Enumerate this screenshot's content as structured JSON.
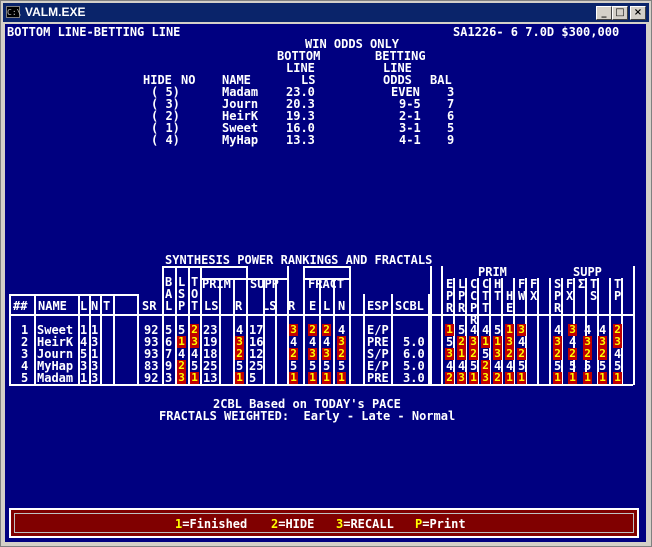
{
  "window": {
    "title": "VALM.EXE",
    "icon_text": "C:\\",
    "buttons": [
      "minimize-icon",
      "maximize-icon",
      "close-icon"
    ]
  },
  "header": {
    "left": "BOTTOM LINE-BETTING LINE",
    "right": "SA1226- 6 7.0D $300,000"
  },
  "odds": {
    "title": "WIN ODDS ONLY",
    "h_bottom": "BOTTOM",
    "h_line": "LINE",
    "h_ls": "LS",
    "h_betting": "BETTING",
    "h_line2": "LINE",
    "h_odds": "ODDS",
    "h_bal": "BAL",
    "h_hide": "HIDE",
    "h_no": "NO",
    "h_name": "NAME",
    "rows": [
      {
        "no": "( 5)",
        "name": "Madam",
        "ls": "23.0",
        "odds": "EVEN",
        "bal": "3"
      },
      {
        "no": "( 3)",
        "name": "Journ",
        "ls": "20.3",
        "odds": "9-5",
        "bal": "7"
      },
      {
        "no": "( 2)",
        "name": "HeirK",
        "ls": "19.3",
        "odds": "2-1",
        "bal": "6"
      },
      {
        "no": "( 1)",
        "name": "Sweet",
        "ls": "16.0",
        "odds": "3-1",
        "bal": "5"
      },
      {
        "no": "( 4)",
        "name": "MyHap",
        "ls": "13.3",
        "odds": "4-1",
        "bal": "9"
      }
    ]
  },
  "synth": {
    "title": "SYNTHESIS POWER RANKINGS AND FRACTALS",
    "headers": {
      "num": "##",
      "name": "NAME",
      "l": "L",
      "n": "N",
      "t": "T",
      "sr": "SR",
      "bal": [
        "B",
        "A",
        "L"
      ],
      "lsp": [
        "L",
        "S",
        "P"
      ],
      "tot": [
        "T",
        "O",
        "T"
      ],
      "prim": "PRIM",
      "ls": "LS",
      "r": "R",
      "supp": "SUPP",
      "ls2": "LS",
      "r2": "R",
      "fract": "FRACT",
      "e": "E",
      "fl": "L",
      "fn": "N",
      "esp": "ESP",
      "scbl": "SCBL",
      "prim2": "PRIM",
      "supp2": "SUPP",
      "epr": [
        "E",
        "P",
        "R"
      ],
      "lpr": [
        "L",
        "P",
        "R"
      ],
      "ccpr": [
        "C",
        "C",
        "P",
        "R"
      ],
      "ctt": [
        "C",
        "T",
        "T"
      ],
      "ht": [
        "H",
        "T"
      ],
      "he": [
        "H",
        "E"
      ],
      "fw": [
        "F",
        "W"
      ],
      "fx": [
        "F",
        "X"
      ],
      "spr": [
        "S",
        "P",
        "R"
      ],
      "sfx": [
        "F",
        "X"
      ],
      "ssig": [
        "Σ"
      ],
      "sts": [
        "T",
        "S"
      ],
      "stp": [
        "T",
        "P"
      ]
    },
    "rows": [
      {
        "num": "1",
        "name": "Sweet",
        "l": "1",
        "n": "1",
        "t": "",
        "sr": "92",
        "bal": "5",
        "lsp": "5",
        "tot": "2",
        "pls": "23",
        "pr": "4",
        "sls": "17",
        "sr2": "3",
        "fe": "2",
        "fl": "2",
        "fn": "4",
        "esp": "E/P",
        "scbl": "",
        "p": [
          "1",
          "5",
          "4",
          "4",
          "5",
          "1",
          "3"
        ],
        "s": [
          "4",
          "3",
          "4",
          "4",
          "2"
        ]
      },
      {
        "num": "2",
        "name": "HeirK",
        "l": "4",
        "n": "3",
        "t": "",
        "sr": "93",
        "bal": "6",
        "lsp": "1",
        "tot": "3",
        "pls": "19",
        "pr": "3",
        "sls": "16",
        "sr2": "4",
        "fe": "4",
        "fl": "4",
        "fn": "3",
        "esp": "PRE",
        "scbl": "5.0",
        "p": [
          "5",
          "2",
          "3",
          "1",
          "1",
          "3",
          "4"
        ],
        "s": [
          "3",
          "4",
          "3",
          "3",
          "3"
        ]
      },
      {
        "num": "3",
        "name": "Journ",
        "l": "5",
        "n": "1",
        "t": "",
        "sr": "93",
        "bal": "7",
        "lsp": "4",
        "tot": "4",
        "pls": "18",
        "pr": "2",
        "sls": "12",
        "sr2": "2",
        "fe": "3",
        "fl": "3",
        "fn": "2",
        "esp": "S/P",
        "scbl": "6.0",
        "p": [
          "3",
          "1",
          "2",
          "5",
          "3",
          "2",
          "2"
        ],
        "s": [
          "2",
          "2",
          "2",
          "2",
          "4"
        ]
      },
      {
        "num": "4",
        "name": "MyHap",
        "l": "3",
        "n": "3",
        "t": "",
        "sr": "83",
        "bal": "9",
        "lsp": "2",
        "tot": "5",
        "pls": "25",
        "pr": "5",
        "sls": "25",
        "sr2": "5",
        "fe": "5",
        "fl": "5",
        "fn": "5",
        "esp": "E/P",
        "scbl": "5.0",
        "p": [
          "4",
          "4",
          "5",
          "2",
          "4",
          "4",
          "5"
        ],
        "s": [
          "5",
          "5",
          "5",
          "5",
          "5"
        ]
      },
      {
        "num": "5",
        "name": "Madam",
        "l": "1",
        "n": "3",
        "t": "",
        "sr": "92",
        "bal": "3",
        "lsp": "3",
        "tot": "1",
        "pls": "13",
        "pr": "1",
        "sls": "5",
        "sr2": "1",
        "fe": "1",
        "fl": "1",
        "fn": "1",
        "esp": "PRE",
        "scbl": "3.0",
        "p": [
          "2",
          "3",
          "1",
          "3",
          "2",
          "1",
          "1"
        ],
        "s": [
          "1",
          "1",
          "1",
          "1",
          "1"
        ]
      }
    ],
    "note1": "2CBL Based on TODAY's PACE",
    "note2": "FRACTALS WEIGHTED:  Early - Late - Normal"
  },
  "footer": {
    "k1": "1",
    "l1": "=Finished",
    "k2": "2",
    "l2": "=HIDE",
    "k3": "3",
    "l3": "=RECALL",
    "k4": "P",
    "l4": "=Print"
  }
}
